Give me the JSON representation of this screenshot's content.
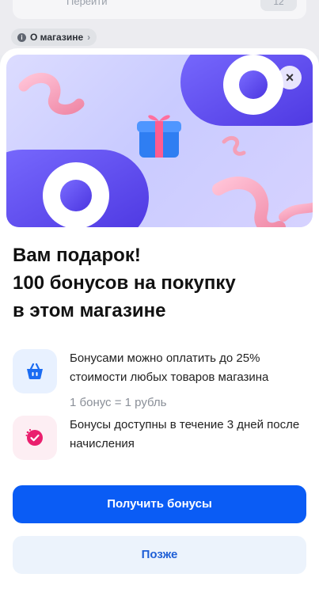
{
  "background": {
    "card_text": "Перейти",
    "card_badge": "12",
    "store_chip": {
      "info_icon": "info-icon",
      "label": "О магазине",
      "chevron": "›"
    }
  },
  "popup": {
    "close_icon": "close-icon",
    "title_lines": [
      "Вам подарок!",
      "100 бонусов на покупку",
      "в этом магазине"
    ],
    "features": [
      {
        "icon": "basket-icon",
        "text": "Бонусами можно оплатить до 25% стоимости любых товаров магазина",
        "subtext": "1 бонус = 1 рубль"
      },
      {
        "icon": "timer-check-icon",
        "text": "Бонусы доступны в течение 3 дней после начисления"
      }
    ],
    "primary_button": "Получить бонусы",
    "secondary_button": "Позже"
  },
  "colors": {
    "accent": "#0a5cf5",
    "secondary_bg": "#ecf3fc",
    "basket_icon": "#1b6cf2",
    "timer_icon": "#ea1f6e",
    "hero_purple": "#6550f0"
  }
}
